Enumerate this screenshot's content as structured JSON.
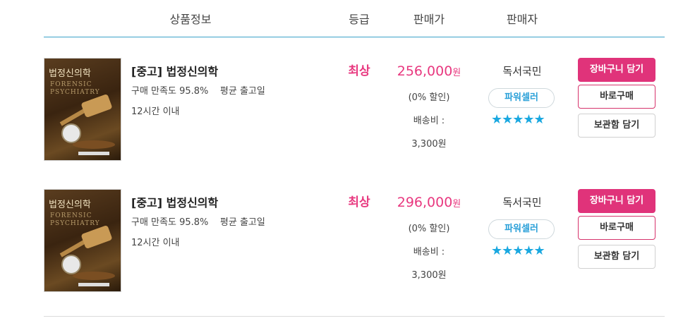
{
  "header": {
    "product_info": "상품정보",
    "grade": "등급",
    "price": "판매가",
    "seller": "판매자"
  },
  "rows": [
    {
      "cover": {
        "title": "법정신의학",
        "subtitle": "FORENSIC PSYCHIATRY"
      },
      "title": "[중고] 법정신의학",
      "meta": "구매 만족도 95.8%    평균 출고일",
      "meta2": "12시간 이내",
      "grade": "최상",
      "price": "256,000",
      "price_unit": "원",
      "discount": "(0% 할인)",
      "shipping_label": "배송비 :",
      "shipping_value": "3,300원",
      "seller": "독서국민",
      "badge": "파워셀러",
      "rating_stars": 5,
      "stars": "★★★★★",
      "cart_label": "장바구니 담기",
      "buy_label": "바로구매",
      "save_label": "보관함 담기"
    },
    {
      "cover": {
        "title": "법정신의학",
        "subtitle": "FORENSIC PSYCHIATRY"
      },
      "title": "[중고] 법정신의학",
      "meta": "구매 만족도 95.8%    평균 출고일",
      "meta2": "12시간 이내",
      "grade": "최상",
      "price": "296,000",
      "price_unit": "원",
      "discount": "(0% 할인)",
      "shipping_label": "배송비 :",
      "shipping_value": "3,300원",
      "seller": "독서국민",
      "badge": "파워셀러",
      "rating_stars": 5,
      "stars": "★★★★★",
      "cart_label": "장바구니 담기",
      "buy_label": "바로구매",
      "save_label": "보관함 담기"
    }
  ],
  "colors": {
    "accent_pink": "#e0337a",
    "header_line": "#3aa1c9",
    "star_blue": "#1aa8e0"
  }
}
